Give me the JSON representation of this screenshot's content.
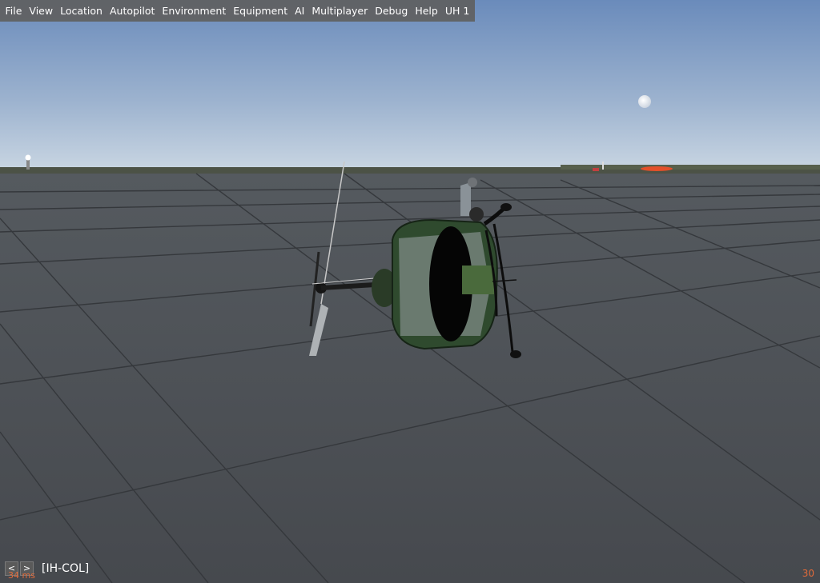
{
  "menu": {
    "items": [
      {
        "label": "File"
      },
      {
        "label": "View"
      },
      {
        "label": "Location"
      },
      {
        "label": "Autopilot"
      },
      {
        "label": "Environment"
      },
      {
        "label": "Equipment"
      },
      {
        "label": "AI"
      },
      {
        "label": "Multiplayer"
      },
      {
        "label": "Debug"
      },
      {
        "label": "Help"
      },
      {
        "label": "UH 1"
      }
    ]
  },
  "hud": {
    "prev_label": "<",
    "next_label": ">",
    "callsign": "[IH-COL]",
    "frame_time": "34 ms",
    "fps": "30"
  },
  "colors": {
    "sky_top": "#6f8fbd",
    "sky_horizon": "#c6d4e2",
    "ground": "#4a4d52",
    "helicopter_green": "#2f4a2e",
    "hud_accent": "#e06a3a"
  }
}
